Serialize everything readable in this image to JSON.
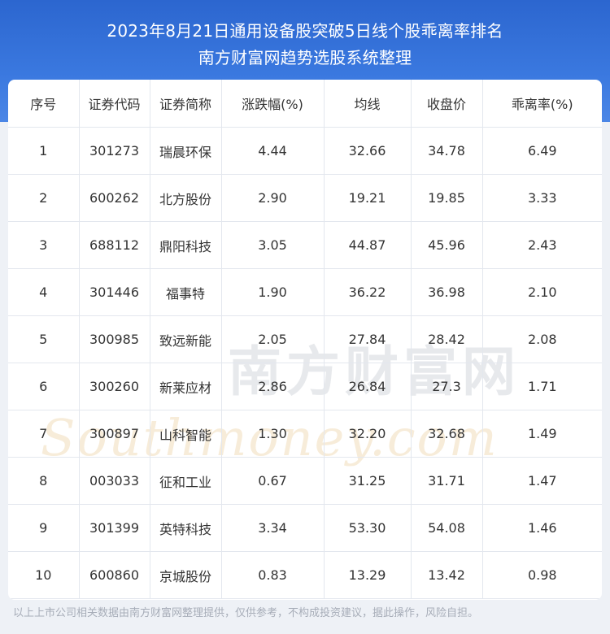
{
  "header": {
    "title_line1": "2023年8月21日通用设备股突破5日线个股乖离率排名",
    "title_line2": "南方财富网趋势选股系统整理"
  },
  "table": {
    "columns": [
      "序号",
      "证券代码",
      "证券简称",
      "涨跌幅(%)",
      "均线",
      "收盘价",
      "乖离率(%)"
    ],
    "rows": [
      [
        "1",
        "301273",
        "瑞晨环保",
        "4.44",
        "32.66",
        "34.78",
        "6.49"
      ],
      [
        "2",
        "600262",
        "北方股份",
        "2.90",
        "19.21",
        "19.85",
        "3.33"
      ],
      [
        "3",
        "688112",
        "鼎阳科技",
        "3.05",
        "44.87",
        "45.96",
        "2.43"
      ],
      [
        "4",
        "301446",
        "福事特",
        "1.90",
        "36.22",
        "36.98",
        "2.10"
      ],
      [
        "5",
        "300985",
        "致远新能",
        "2.05",
        "27.84",
        "28.42",
        "2.08"
      ],
      [
        "6",
        "300260",
        "新莱应材",
        "2.86",
        "26.84",
        "27.3",
        "1.71"
      ],
      [
        "7",
        "300897",
        "山科智能",
        "1.30",
        "32.20",
        "32.68",
        "1.49"
      ],
      [
        "8",
        "003033",
        "征和工业",
        "0.67",
        "31.25",
        "31.71",
        "1.47"
      ],
      [
        "9",
        "301399",
        "英特科技",
        "3.34",
        "53.30",
        "54.08",
        "1.46"
      ],
      [
        "10",
        "600860",
        "京城股份",
        "0.83",
        "13.29",
        "13.42",
        "0.98"
      ]
    ]
  },
  "watermark": {
    "cn": "南方财富网",
    "en": "Southmoney.com"
  },
  "footer": {
    "note": "以上上市公司相关数据由南方财富网整理提供，仅供参考，不构成投资建议，据此操作，风险自担。"
  }
}
